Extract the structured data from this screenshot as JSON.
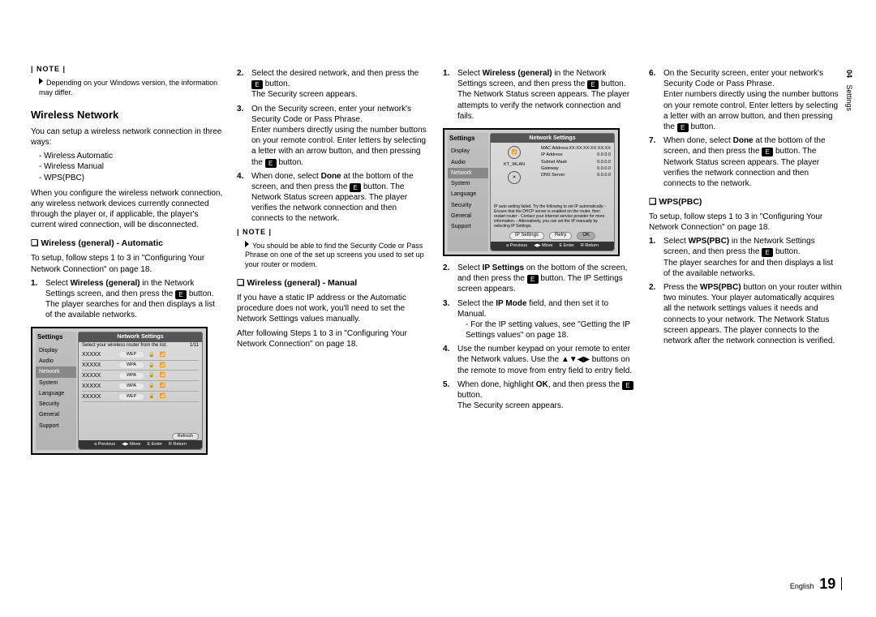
{
  "side_tab": {
    "chapter": "04",
    "title": "Settings"
  },
  "footer": {
    "language": "English",
    "page": "19"
  },
  "col1": {
    "note_label": "| NOTE |",
    "note1": "Depending on your Windows version, the information may differ.",
    "h2": "Wireless Network",
    "intro": "You can setup a wireless network connection in three ways:",
    "methods": [
      "Wireless Automatic",
      "Wireless Manual",
      "WPS(PBC)"
    ],
    "warn": "When you configure the wireless network connection, any wireless network devices currently connected through the player or, if applicable, the player's current wired connection, will be disconnected.",
    "sub1": "Wireless (general) - Automatic",
    "sub1_intro": "To setup, follow steps 1 to 3 in \"Configuring Your Network Connection\" on page 18.",
    "step1_a": "Select ",
    "step1_b": "Wireless (general)",
    "step1_c": " in the Network Settings screen, and then press the ",
    "step1_d": " button.",
    "step1_e": "The player searches for and then displays a list of the available networks.",
    "inset1": {
      "title": "Settings",
      "menu": [
        "Display",
        "Audio",
        "Network",
        "System",
        "Language",
        "Security",
        "General",
        "Support"
      ],
      "header": "Network Settings",
      "hint": "Select your wireless router from the list.",
      "count": "1/11",
      "rows": [
        {
          "ssid": "XXXXX",
          "sec": "WEP"
        },
        {
          "ssid": "XXXXX",
          "sec": "WPA"
        },
        {
          "ssid": "XXXXX",
          "sec": "WPA"
        },
        {
          "ssid": "XXXXX",
          "sec": "WPA"
        },
        {
          "ssid": "XXXXX",
          "sec": "WEP"
        }
      ],
      "refresh": "Refresh",
      "nav": [
        "a Previous",
        "◀▶ Move",
        "E Enter",
        "R Return"
      ]
    }
  },
  "col2": {
    "s2_a": "Select the desired network, and then press the ",
    "s2_b": " button.",
    "s2_c": "The Security screen appears.",
    "s3_a": "On the Security screen, enter your network's Security Code or Pass Phrase.",
    "s3_b": "Enter numbers directly using the number buttons on your remote control. Enter letters by selecting a letter with an arrow button, and then pressing the ",
    "s3_c": " button.",
    "s4_a": "When done, select ",
    "s4_done": "Done",
    "s4_b": " at the bottom of the screen, and then press the ",
    "s4_c": " button. The Network Status screen appears. The player verifies the network connection and then connects to the network.",
    "note_label": "| NOTE |",
    "note2": "You should be able to find the Security Code or Pass Phrase on one of the set up screens you used to set up your router or modem.",
    "sub2": "Wireless (general) - Manual",
    "man1": "If you have a static IP address or the Automatic procedure does not work, you'll need to set the Network Settings values manually.",
    "man2": "After following Steps 1 to 3 in \"Configuring Your Network Connection\" on page 18."
  },
  "col3": {
    "s1_a": "Select ",
    "s1_b": "Wireless (general)",
    "s1_c": " in the Network Settings screen, and then press the ",
    "s1_d": " button.",
    "s1_e": "The Network Status screen appears. The player attempts to verify the network connection and fails.",
    "inset2": {
      "title": "Settings",
      "menu": [
        "Display",
        "Audio",
        "Network",
        "System",
        "Language",
        "Security",
        "General",
        "Support"
      ],
      "header": "Network Settings",
      "ap": "KT_WLAN",
      "pairs": [
        {
          "k": "MAC Address",
          "v": "XX:XX:XX:XX:XX:XX"
        },
        {
          "k": "IP Address",
          "v": "0.0.0.0"
        },
        {
          "k": "Subnet Mask",
          "v": "0.0.0.0"
        },
        {
          "k": "Gateway",
          "v": "0.0.0.0"
        },
        {
          "k": "DNS Server",
          "v": "0.0.0.0"
        }
      ],
      "msg": "IP auto setting failed. Try the following to set IP automatically:\n - Ensure that the DHCP server is enabled on the router, then restart router\n - Contact your Internet service provider for more information.\n - Alternatively, you can set the IP manually by selecting IP Settings.",
      "btns": [
        "IP Settings",
        "Retry",
        "OK"
      ],
      "nav": [
        "a Previous",
        "◀▶ Move",
        "E Enter",
        "R Return"
      ]
    },
    "s2_a": "Select ",
    "s2_b": "IP Settings",
    "s2_c": " on the bottom of the screen, and then press the ",
    "s2_d": " button. The IP Settings screen appears.",
    "s3_a": "Select the ",
    "s3_b": "IP Mode",
    "s3_c": " field, and then set it to Manual.",
    "s3_d": "For the IP setting values, see \"Getting the IP Settings values\" on page 18.",
    "s4_a": "Use the number keypad on your remote to enter the Network values. Use the ",
    "s4_arrows": "▲▼◀▶",
    "s4_b": " buttons on the remote to move from entry field to entry field.",
    "s5_a": "When done, highlight ",
    "s5_b": "OK",
    "s5_c": ", and then press the ",
    "s5_d": " button.",
    "s5_e": "The Security screen appears."
  },
  "col4": {
    "s6_a": "On the Security screen, enter your network's Security Code or Pass Phrase.",
    "s6_b": "Enter numbers directly using the number buttons on your remote control. Enter letters by selecting a letter with an arrow button, and then pressing the ",
    "s6_c": " button.",
    "s7_a": "When done, select ",
    "s7_done": "Done",
    "s7_b": " at the bottom of the screen, and then press the ",
    "s7_c": " button. The Network Status screen appears. The player verifies the network connection and then connects to the network.",
    "sub3": "WPS(PBC)",
    "wps_intro": "To setup, follow steps 1 to 3 in \"Configuring Your Network Connection\" on page 18.",
    "w1_a": "Select ",
    "w1_b": "WPS(PBC)",
    "w1_c": " in the Network Settings screen, and then press the ",
    "w1_d": " button.",
    "w1_e": "The player searches for and then displays a list of the available networks.",
    "w2_a": "Press the ",
    "w2_b": "WPS(PBC)",
    "w2_c": " button on your router within two minutes. Your player automatically acquires all the network settings values it needs and connects to your network. The Network Status screen appears. The player connects to the network after the network connection is verified."
  }
}
